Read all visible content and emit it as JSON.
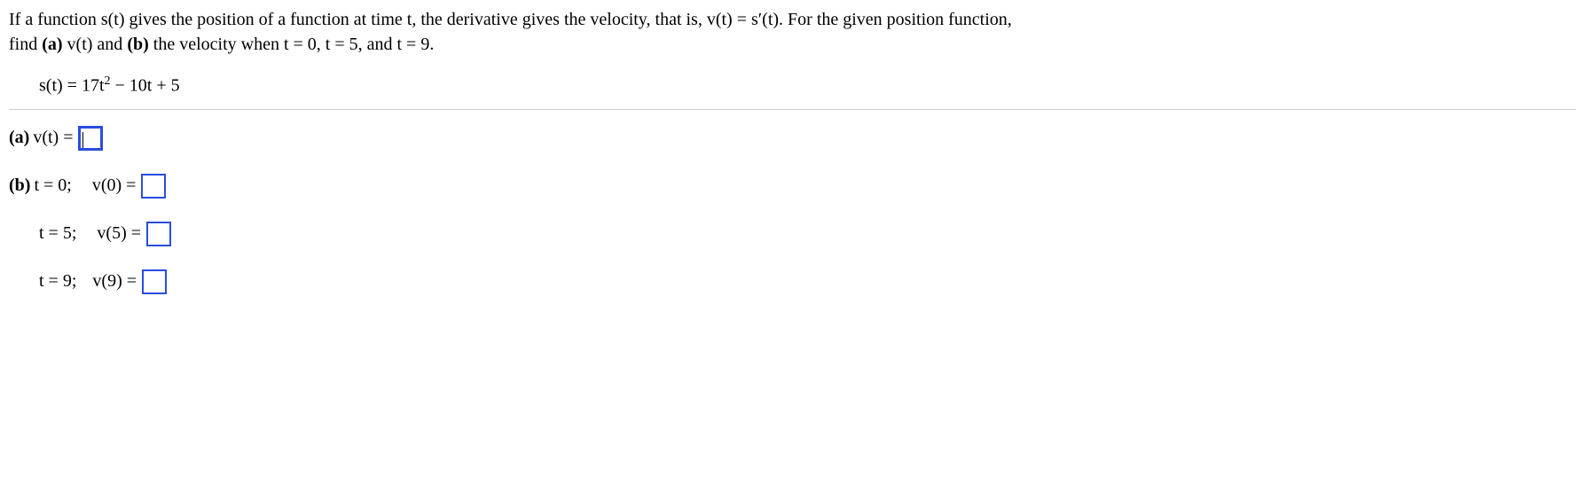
{
  "intro": {
    "line1_part1": "If a function s(t) gives the position of a function at time t, the derivative gives the velocity, that is, v(t) = s",
    "line1_prime": "′",
    "line1_part2": "(t). For the given position function,",
    "line2_part1": "find ",
    "line2_a": "(a)",
    "line2_part2": " v(t) and ",
    "line2_b": "(b)",
    "line2_part3": " the velocity when t = 0, t = 5, and t = 9."
  },
  "equation": {
    "lhs": "s(t) = 17t",
    "exp": "2",
    "rest": " − 10t + 5"
  },
  "parts": {
    "a": {
      "label": "(a)",
      "expr": " v(t) = "
    },
    "b": {
      "label": "(b)",
      "row1_prefix": " t = 0;",
      "row1_expr": "v(0) = ",
      "row2_prefix": "t = 5;",
      "row2_expr": "v(5) = ",
      "row3_prefix": "t = 9;",
      "row3_expr": "v(9) = "
    }
  }
}
